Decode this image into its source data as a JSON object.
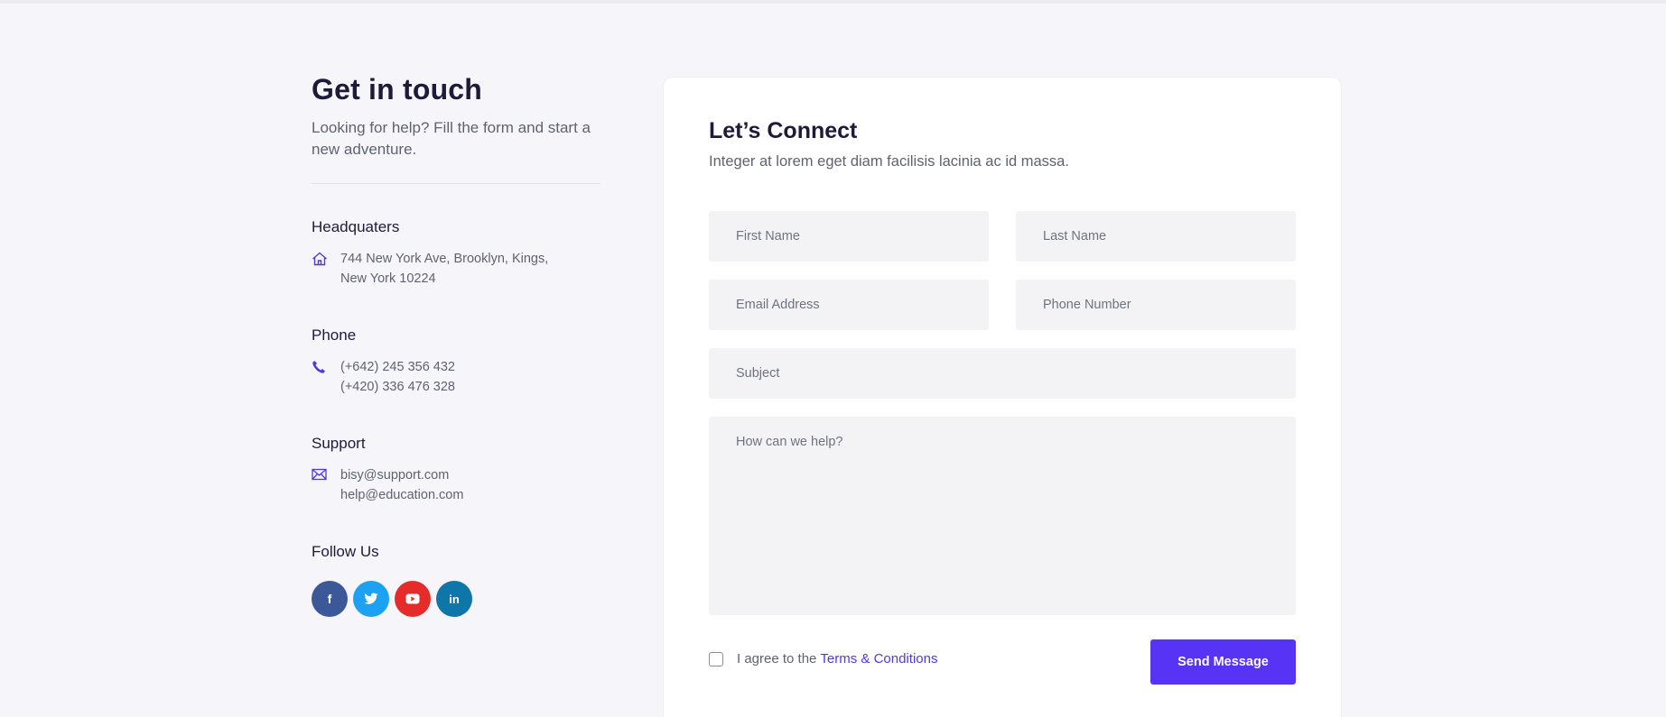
{
  "contact": {
    "title": "Get in touch",
    "lead": "Looking for help? Fill the form and start a new adventure.",
    "headquarters": {
      "heading": "Headquaters",
      "line1": "744 New York Ave, Brooklyn, Kings,",
      "line2": "New York 10224",
      "icon": "home-icon"
    },
    "phone": {
      "heading": "Phone",
      "line1": "(+642) 245 356 432",
      "line2": "(+420) 336 476 328",
      "icon": "phone-icon"
    },
    "support": {
      "heading": "Support",
      "line1": "bisy@support.com",
      "line2": "help@education.com",
      "icon": "mail-icon"
    },
    "follow": {
      "heading": "Follow Us",
      "socials": [
        {
          "name": "facebook-icon",
          "glyph": "f",
          "color": "#3b5998"
        },
        {
          "name": "twitter-icon",
          "glyph": "t",
          "color": "#1da1f2"
        },
        {
          "name": "youtube-icon",
          "glyph": "▶",
          "color": "#e62b2b"
        },
        {
          "name": "linkedin-icon",
          "glyph": "in",
          "color": "#0e76a8"
        }
      ]
    }
  },
  "form": {
    "title": "Let’s Connect",
    "subtitle": "Integer at lorem eget diam facilisis lacinia ac id massa.",
    "first_name_placeholder": "First Name",
    "last_name_placeholder": "Last Name",
    "email_placeholder": "Email Address",
    "phone_placeholder": "Phone Number",
    "subject_placeholder": "Subject",
    "message_placeholder": "How can we help?",
    "agree_text": "I agree to the",
    "terms_link": "Terms & Conditions",
    "submit_label": "Send Message",
    "accent_color": "#5733f5"
  }
}
